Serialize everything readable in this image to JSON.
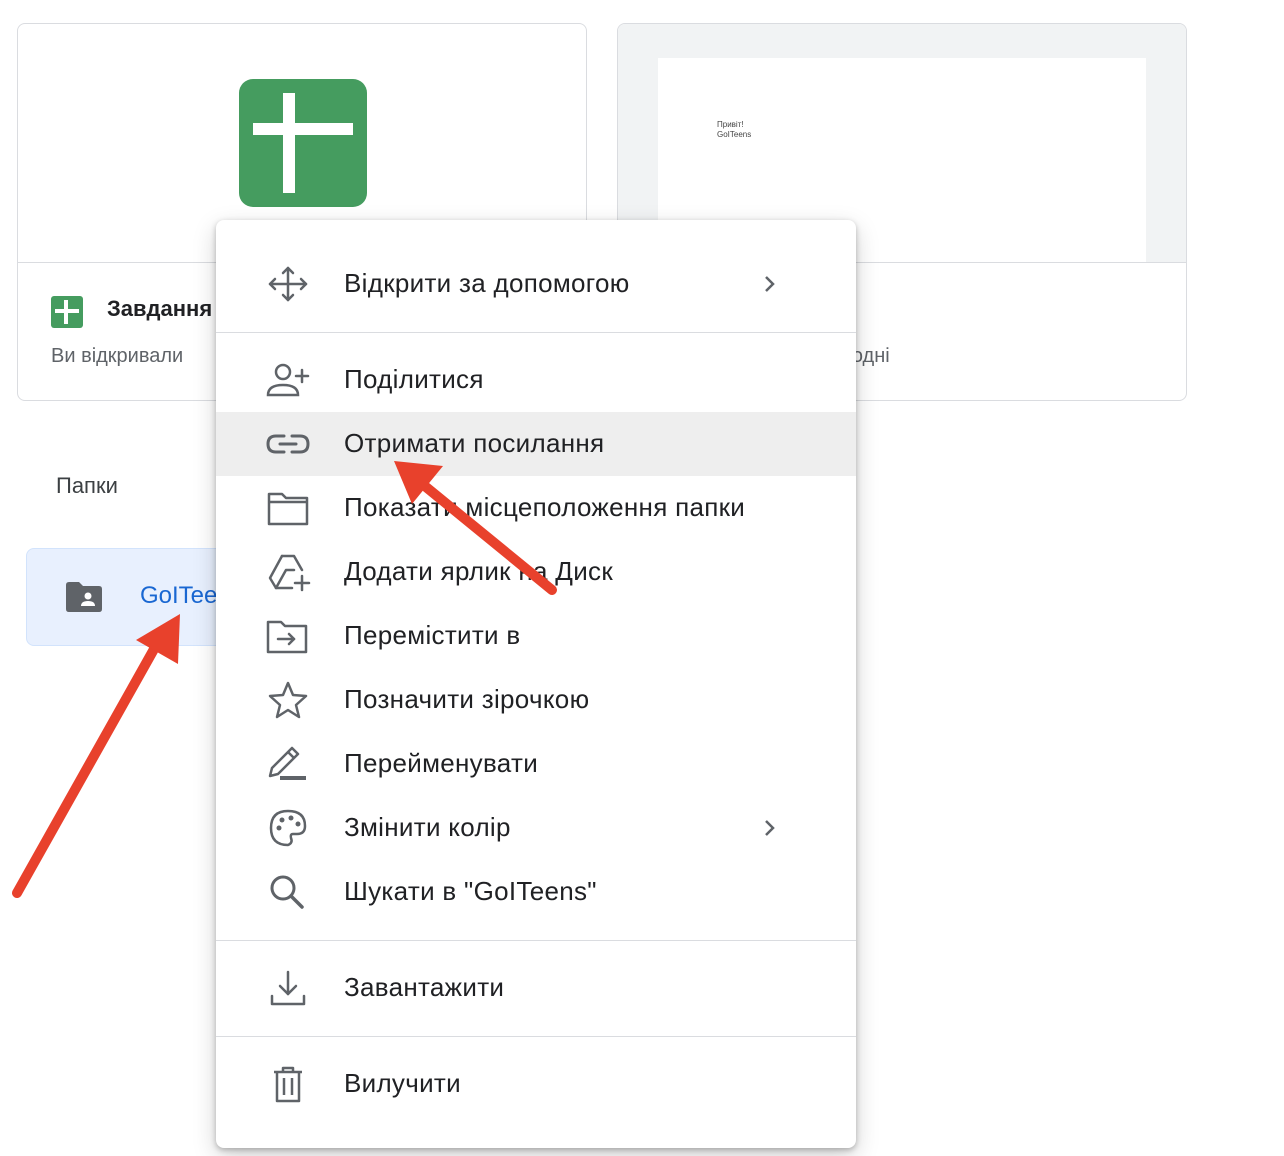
{
  "cards": [
    {
      "title": "Завдання",
      "subtitle": "Ви відкривали"
    },
    {
      "subtitle": "годні",
      "doc_lines": [
        "Привіт!",
        "GoITeens"
      ]
    }
  ],
  "sections": {
    "folders_label": "Папки"
  },
  "folder": {
    "name": "GoITees"
  },
  "menu": {
    "items": [
      {
        "label": "Відкрити за допомогою",
        "icon": "open-with-icon",
        "submenu": true
      },
      {
        "label": "Поділитися",
        "icon": "share-person-add-icon"
      },
      {
        "label": "Отримати посилання",
        "icon": "link-icon",
        "highlighted": true
      },
      {
        "label": "Показати місцеположення папки",
        "icon": "folder-outline-icon"
      },
      {
        "label": "Додати ярлик на Диск",
        "icon": "add-shortcut-drive-icon"
      },
      {
        "label": "Перемістити в",
        "icon": "move-to-folder-icon"
      },
      {
        "label": "Позначити зірочкою",
        "icon": "star-icon"
      },
      {
        "label": "Перейменувати",
        "icon": "rename-pencil-icon"
      },
      {
        "label": "Змінити колір",
        "icon": "palette-icon",
        "submenu": true
      },
      {
        "label": "Шукати в \"GoITeens\"",
        "icon": "search-icon"
      },
      {
        "label": "Завантажити",
        "icon": "download-icon"
      },
      {
        "label": "Вилучити",
        "icon": "trash-icon"
      }
    ]
  },
  "colors": {
    "accent_red": "#e8412c",
    "sheets_green": "#459c5f",
    "folder_blue": "#1967d2",
    "highlight": "#eeeeee"
  }
}
